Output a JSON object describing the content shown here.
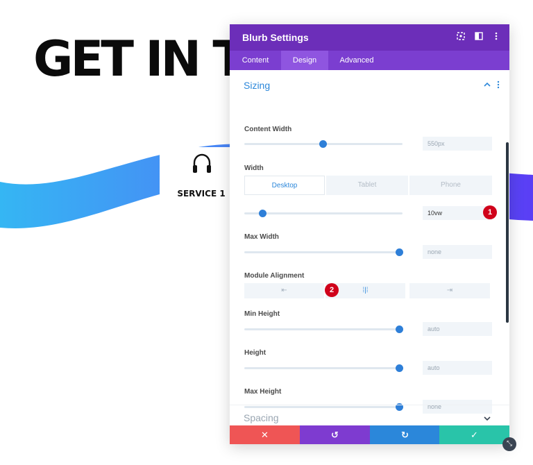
{
  "page": {
    "heading": "GET IN TO",
    "service_label": "SERVICE 1"
  },
  "colors": {
    "header": "#6c2eb9",
    "tabs_bar": "#7b3ed0",
    "accent": "#2b87da",
    "badge": "#d0021b",
    "cancel": "#ef5555",
    "undo": "#7e3bd0",
    "redo": "#2b87da",
    "save": "#29c4a9"
  },
  "modal": {
    "title": "Blurb Settings",
    "header_icons": [
      "screenshot-icon",
      "split-view-icon",
      "more-vertical-icon"
    ],
    "tabs": [
      {
        "label": "Content",
        "active": false
      },
      {
        "label": "Design",
        "active": true
      },
      {
        "label": "Advanced",
        "active": false
      }
    ],
    "section": {
      "title": "Sizing",
      "fields": {
        "content_width": {
          "label": "Content Width",
          "value": "550px",
          "slider_fraction": 0.5
        },
        "width": {
          "label": "Width",
          "devices": [
            "Desktop",
            "Tablet",
            "Phone"
          ],
          "active_device": "Desktop",
          "value": "10vw",
          "slider_fraction": 0.12
        },
        "max_width": {
          "label": "Max Width",
          "value": "none",
          "slider_fraction": 0.98
        },
        "module_alignment": {
          "label": "Module Alignment",
          "options": [
            "left-align-icon",
            "center-align-icon",
            "right-align-icon"
          ],
          "active": "center-align-icon"
        },
        "min_height": {
          "label": "Min Height",
          "value": "auto",
          "slider_fraction": 0.98
        },
        "height": {
          "label": "Height",
          "value": "auto",
          "slider_fraction": 0.98
        },
        "max_height": {
          "label": "Max Height",
          "value": "none",
          "slider_fraction": 0.98
        }
      }
    },
    "collapsed_section": {
      "title": "Spacing"
    },
    "annotations": [
      "1",
      "2"
    ],
    "footer_icons": [
      "close-icon",
      "undo-icon",
      "redo-icon",
      "check-icon"
    ]
  }
}
